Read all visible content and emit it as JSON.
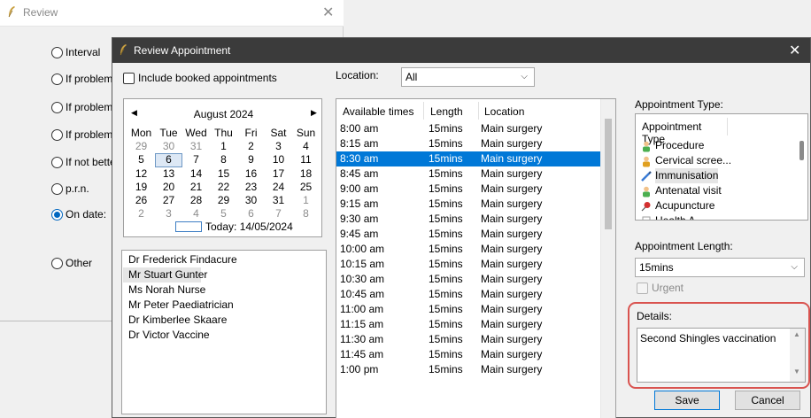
{
  "review_window": {
    "title": "Review",
    "options": [
      {
        "label": "Interval",
        "checked": false
      },
      {
        "label": "If problem p",
        "checked": false
      },
      {
        "label": "If problem w",
        "checked": false
      },
      {
        "label": "If problem n",
        "checked": false
      },
      {
        "label": "If not bettei",
        "checked": false
      },
      {
        "label": "p.r.n.",
        "checked": false
      },
      {
        "label": "On date:",
        "checked": true
      },
      {
        "label": "Other",
        "checked": false
      }
    ]
  },
  "dialog": {
    "title": "Review Appointment",
    "close_glyph": "✕",
    "include_booked_label": "Include booked appointments",
    "calendar": {
      "month_label": "August 2024",
      "prev_glyph": "◀",
      "next_glyph": "▶",
      "day_headers": [
        "Mon",
        "Tue",
        "Wed",
        "Thu",
        "Fri",
        "Sat",
        "Sun"
      ],
      "weeks": [
        [
          "29",
          "30",
          "31",
          "1",
          "2",
          "3",
          "4"
        ],
        [
          "5",
          "6",
          "7",
          "8",
          "9",
          "10",
          "11"
        ],
        [
          "12",
          "13",
          "14",
          "15",
          "16",
          "17",
          "18"
        ],
        [
          "19",
          "20",
          "21",
          "22",
          "23",
          "24",
          "25"
        ],
        [
          "26",
          "27",
          "28",
          "29",
          "30",
          "31",
          "1"
        ],
        [
          "2",
          "3",
          "4",
          "5",
          "6",
          "7",
          "8"
        ]
      ],
      "selected_day": "6",
      "today_label": "Today: 14/05/2024"
    },
    "clinicians": [
      "Dr Frederick Findacure",
      "Mr Stuart Gunter",
      "Ms Norah Nurse",
      "Mr Peter Paediatrician",
      "Dr Kimberlee Skaare",
      "Dr Victor Vaccine"
    ],
    "selected_clinician": "Mr Stuart Gunter",
    "location_label": "Location:",
    "location_value": "All",
    "times_columns": [
      "Available times",
      "Length",
      "Location"
    ],
    "times": [
      [
        "8:00 am",
        "15mins",
        "Main surgery"
      ],
      [
        "8:15 am",
        "15mins",
        "Main surgery"
      ],
      [
        "8:30 am",
        "15mins",
        "Main surgery"
      ],
      [
        "8:45 am",
        "15mins",
        "Main surgery"
      ],
      [
        "9:00 am",
        "15mins",
        "Main surgery"
      ],
      [
        "9:15 am",
        "15mins",
        "Main surgery"
      ],
      [
        "9:30 am",
        "15mins",
        "Main surgery"
      ],
      [
        "9:45 am",
        "15mins",
        "Main surgery"
      ],
      [
        "10:00 am",
        "15mins",
        "Main surgery"
      ],
      [
        "10:15 am",
        "15mins",
        "Main surgery"
      ],
      [
        "10:30 am",
        "15mins",
        "Main surgery"
      ],
      [
        "10:45 am",
        "15mins",
        "Main surgery"
      ],
      [
        "11:00 am",
        "15mins",
        "Main surgery"
      ],
      [
        "11:15 am",
        "15mins",
        "Main surgery"
      ],
      [
        "11:30 am",
        "15mins",
        "Main surgery"
      ],
      [
        "11:45 am",
        "15mins",
        "Main surgery"
      ],
      [
        "1:00 pm",
        "15mins",
        "Main surgery"
      ]
    ],
    "selected_time": "8:30 am",
    "appointment_type_label": "Appointment Type:",
    "appointment_type_header": "Appointment Type",
    "appointment_types": [
      {
        "label": "Procedure",
        "icon": "person-green-icon",
        "color": "#4caf50"
      },
      {
        "label": "Cervical scree...",
        "icon": "person-orange-icon",
        "color": "#e0a020"
      },
      {
        "label": "Immunisation",
        "icon": "syringe-icon",
        "color": "#3a7bd5"
      },
      {
        "label": "Antenatal visit",
        "icon": "person-green-icon",
        "color": "#4caf50"
      },
      {
        "label": "Acupuncture",
        "icon": "pin-icon",
        "color": "#d32f2f"
      },
      {
        "label": "Health A...",
        "icon": "document-icon",
        "color": "#9e9e9e"
      }
    ],
    "selected_type": "Immunisation",
    "appointment_length_label": "Appointment Length:",
    "appointment_length_value": "15mins",
    "urgent_label": "Urgent",
    "details_label": "Details:",
    "details_text": "Second Shingles vaccination",
    "save_label": "Save",
    "cancel_label": "Cancel",
    "colors": {
      "selection": "#0078d7",
      "highlight": "#d9534f",
      "titlebar": "#3b3b3b"
    }
  }
}
